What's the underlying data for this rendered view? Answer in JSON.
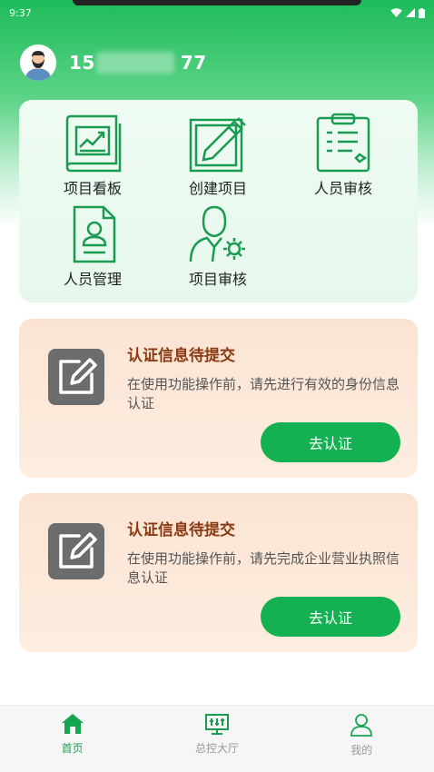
{
  "status_bar": {
    "time": "9:37"
  },
  "user": {
    "phone_prefix": "15",
    "phone_suffix": "77"
  },
  "menu": {
    "items": [
      {
        "label": "项目看板",
        "icon": "project-board-icon"
      },
      {
        "label": "创建项目",
        "icon": "create-project-icon"
      },
      {
        "label": "人员审核",
        "icon": "personnel-review-icon"
      },
      {
        "label": "人员管理",
        "icon": "personnel-management-icon"
      },
      {
        "label": "项目审核",
        "icon": "project-review-icon"
      }
    ]
  },
  "auth_cards": [
    {
      "title": "认证信息待提交",
      "description": "在使用功能操作前，请先进行有效的身份信息认证",
      "button": "去认证"
    },
    {
      "title": "认证信息待提交",
      "description": "在使用功能操作前，请先完成企业营业执照信息认证",
      "button": "去认证"
    }
  ],
  "bottom_nav": {
    "items": [
      {
        "label": "首页",
        "icon": "home-icon",
        "active": true
      },
      {
        "label": "总控大厅",
        "icon": "control-hall-icon",
        "active": false
      },
      {
        "label": "我的",
        "icon": "profile-icon",
        "active": false
      }
    ]
  },
  "colors": {
    "brand_green": "#13b152",
    "icon_green": "#1a9b52",
    "card_title": "#8a3a12"
  }
}
